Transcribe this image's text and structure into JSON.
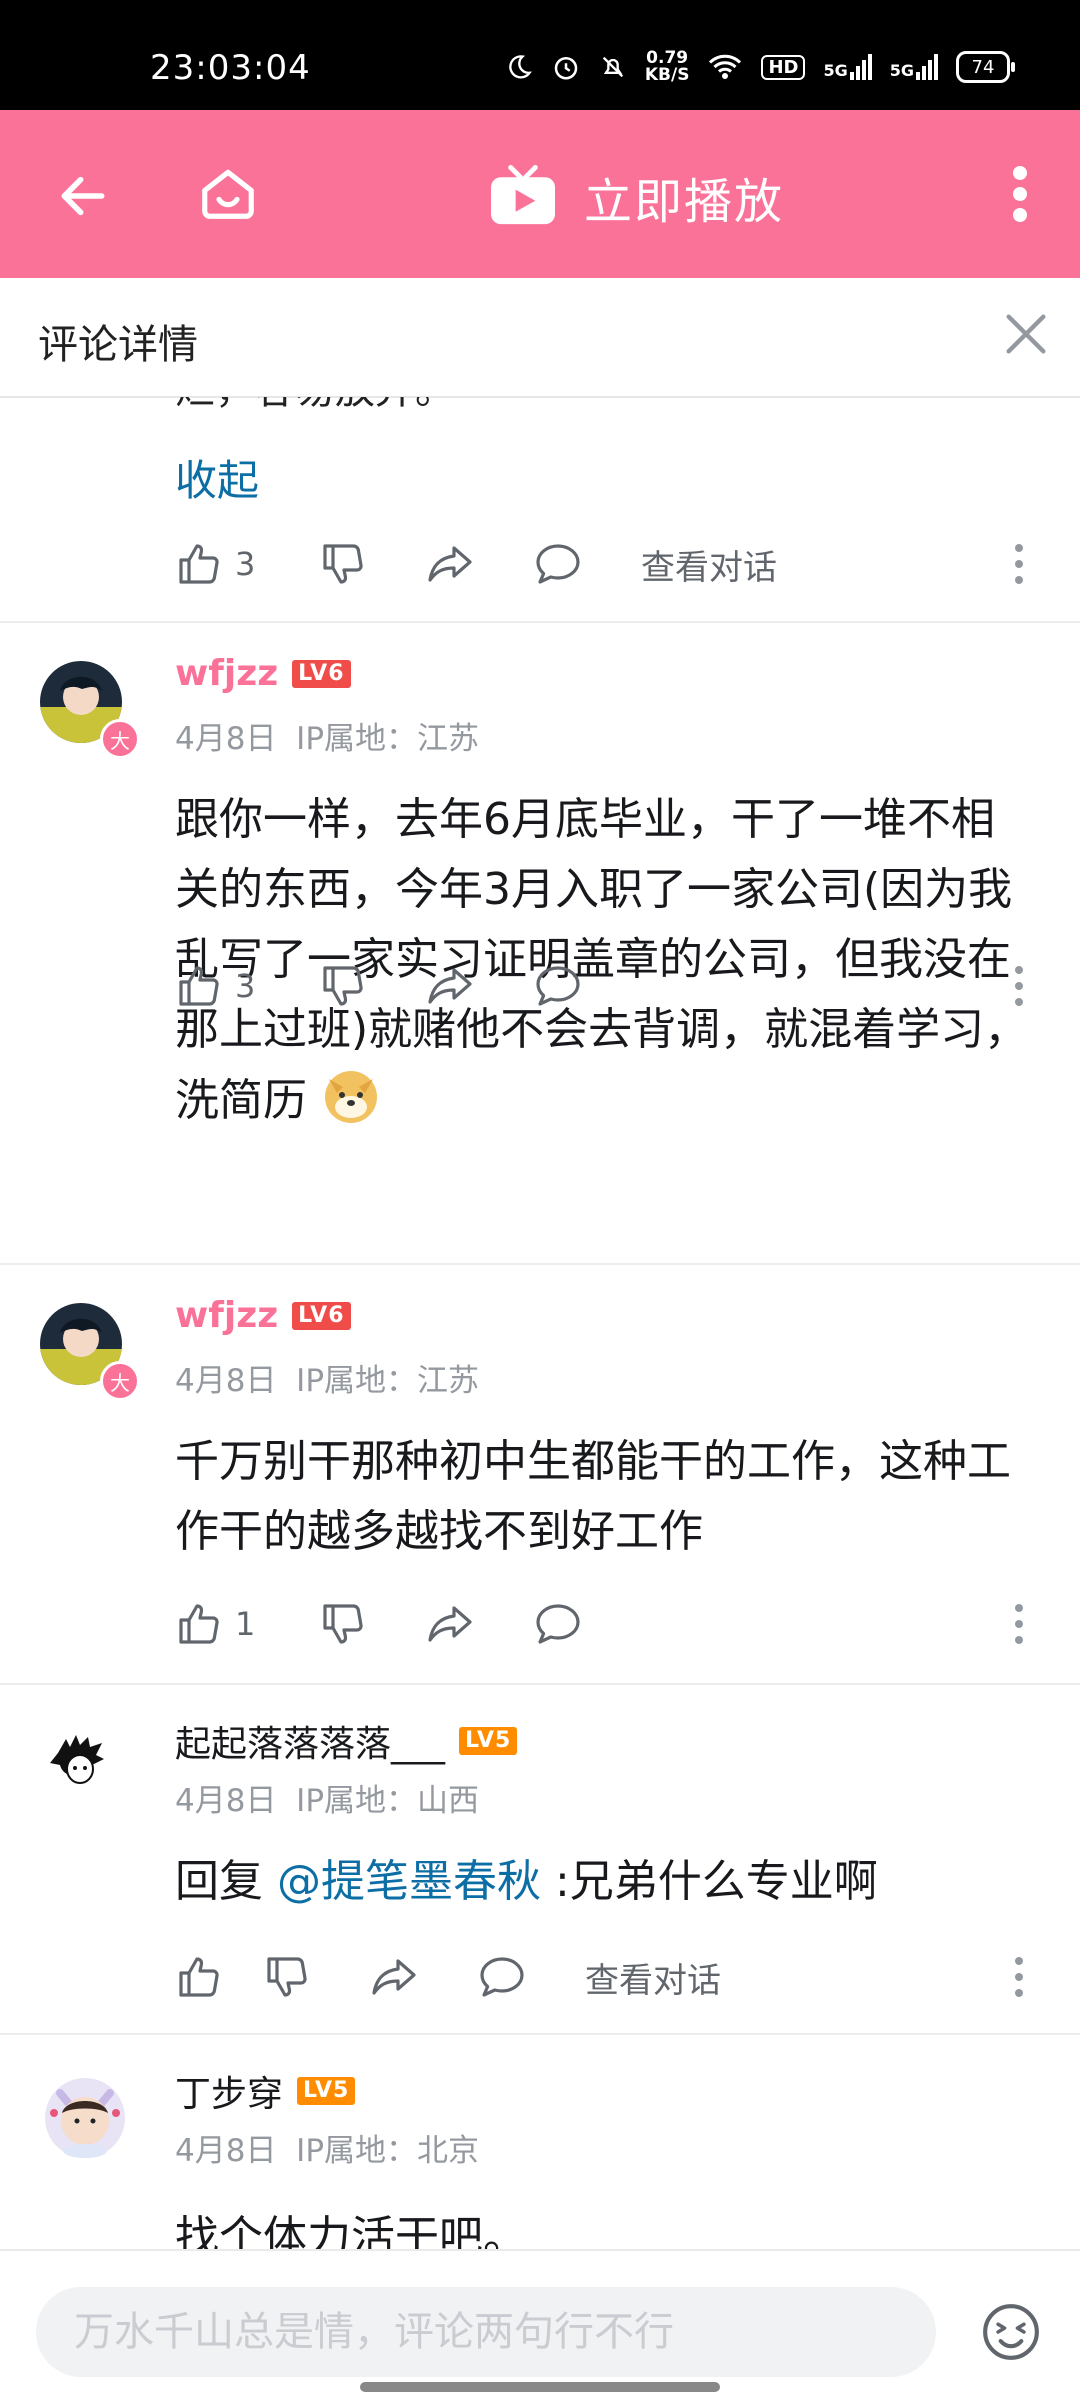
{
  "status_bar": {
    "time": "23:03:04",
    "speed_value": "0.79",
    "speed_unit": "KB/S",
    "hd_badge": "HD",
    "net1": "5G",
    "net2": "5G",
    "battery": "74"
  },
  "app_bar": {
    "play_label": "立即播放",
    "icons": [
      "back-arrow-icon",
      "home-icon",
      "tv-play-icon",
      "more-vertical-icon"
    ]
  },
  "panel": {
    "title": "评论详情"
  },
  "partial_comment": {
    "text_tail": "烂，容易放弃。",
    "collapse_label": "收起",
    "likes": "3",
    "view_conversation": "查看对话"
  },
  "comments": [
    {
      "username": "wfjzz",
      "level": "LV6",
      "big_member_badge": "大",
      "date": "4月8日",
      "ip": "IP属地：江苏",
      "text": "跟你一样，去年6月底毕业，干了一堆不相关的东西，今年3月入职了一家公司(因为我乱写了一家实习证明盖章的公司，但我没在那上过班)就赌他不会去背调，就混着学习，洗简历",
      "likes": "3"
    },
    {
      "username": "wfjzz",
      "level": "LV6",
      "big_member_badge": "大",
      "date": "4月8日",
      "ip": "IP属地：江苏",
      "text": "千万别干那种初中生都能干的工作，这种工作干的越多越找不到好工作",
      "likes": "1"
    },
    {
      "username": "起起落落落落___",
      "level": "LV5",
      "date": "4月8日",
      "ip": "IP属地：山西",
      "reply_prefix": "回复 ",
      "mention": "@提笔墨春秋",
      "text": " :兄弟什么专业啊",
      "view_conversation": "查看对话"
    },
    {
      "username": "丁步穿",
      "level": "LV5",
      "date": "4月8日",
      "ip": "IP属地：北京",
      "text": "找个体力活干吧。"
    }
  ],
  "colors": {
    "brand_pink": "#fb7299",
    "link_blue": "#0d6ea5",
    "lv6_red": "#f04c49",
    "lv5_orange": "#ff8c00"
  },
  "bottom": {
    "placeholder": "万水千山总是情，评论两句行不行",
    "emoji_icon": "emoji-icon"
  }
}
